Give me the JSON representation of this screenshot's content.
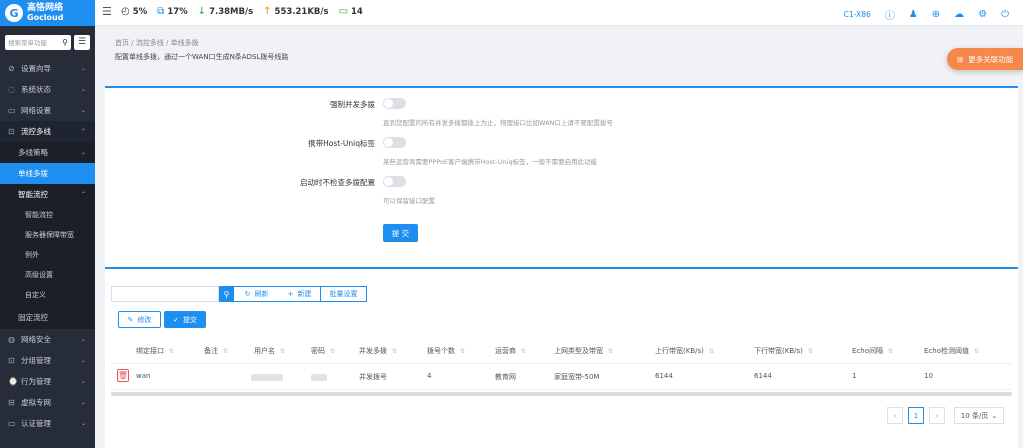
{
  "brand": {
    "cn": "高恪网络",
    "en": "Gocloud"
  },
  "stats": [
    {
      "icon": "◴",
      "value": "5%"
    },
    {
      "icon": "⧉",
      "value": "17%"
    },
    {
      "icon": "↓",
      "value": "7.38MB/s"
    },
    {
      "icon": "↑",
      "value": "553.21KB/s"
    },
    {
      "icon": "▭",
      "value": "14"
    }
  ],
  "topbar": {
    "model": "C1-X86"
  },
  "sidebar": {
    "search_placeholder": "搜索菜单功能",
    "items": [
      {
        "icon": "⊘",
        "label": "设置向导"
      },
      {
        "icon": "◌",
        "label": "系统状态"
      },
      {
        "icon": "▭",
        "label": "网络设置"
      },
      {
        "icon": "⊡",
        "label": "流控多线"
      }
    ],
    "sub": [
      {
        "label": "多线策略"
      },
      {
        "label": "单线多拨"
      },
      {
        "label": "智能流控"
      }
    ],
    "sub2": [
      {
        "label": "智能流控"
      },
      {
        "label": "服务器保障带宽"
      },
      {
        "label": "例外"
      },
      {
        "label": "高级设置"
      },
      {
        "label": "自定义"
      }
    ],
    "after_sub": {
      "label": "固定流控"
    },
    "bottom": [
      {
        "icon": "◍",
        "label": "网络安全"
      },
      {
        "icon": "⊡",
        "label": "分组管理"
      },
      {
        "icon": "⌚",
        "label": "行为管理"
      },
      {
        "icon": "⊟",
        "label": "虚拟专网"
      },
      {
        "icon": "▭",
        "label": "认证管理"
      }
    ]
  },
  "header": {
    "breadcrumb": "首页  /  流控多线  /  单线多拨",
    "description": "配置单线多拨，通过一个WAN口生成N条ADSL拨号线路",
    "more_button": "更多关联功能"
  },
  "form": {
    "fields": [
      {
        "label": "强制并发多拨",
        "help": "直到您配置的所有并发多拨都拨上为止，物理接口比如WAN口上请不要配置拨号"
      },
      {
        "label": "携带Host-Uniq标签",
        "help": "某些运营商需要PPPoE客户端携带Host-Uniq标签，一般不需要启用此功能"
      },
      {
        "label": "启动时不检查多拨配置",
        "help": "可以保留接口配置"
      }
    ],
    "submit": "提 交"
  },
  "table": {
    "toolbar": {
      "refresh": "刷新",
      "new": "新建",
      "batch": "批量设置"
    },
    "edit": "修改",
    "submit": "提交",
    "columns": [
      "绑定接口",
      "备注",
      "用户名",
      "密码",
      "并发多拨",
      "拨号个数",
      "运营商",
      "上网类型及带宽",
      "上行带宽(KB/s)",
      "下行带宽(KB/s)",
      "Echo间隔",
      "Echo检测阈值"
    ],
    "rows": [
      {
        "iface": "wan",
        "remark": "",
        "user": "",
        "pass": "",
        "concurrent": "并发拨号",
        "count": "4",
        "isp": "教育网",
        "type": "家庭宽带-50M",
        "up": "6144",
        "down": "6144",
        "echo": "1",
        "thresh": "10"
      }
    ],
    "page": "1",
    "page_size": "10 条/页"
  }
}
